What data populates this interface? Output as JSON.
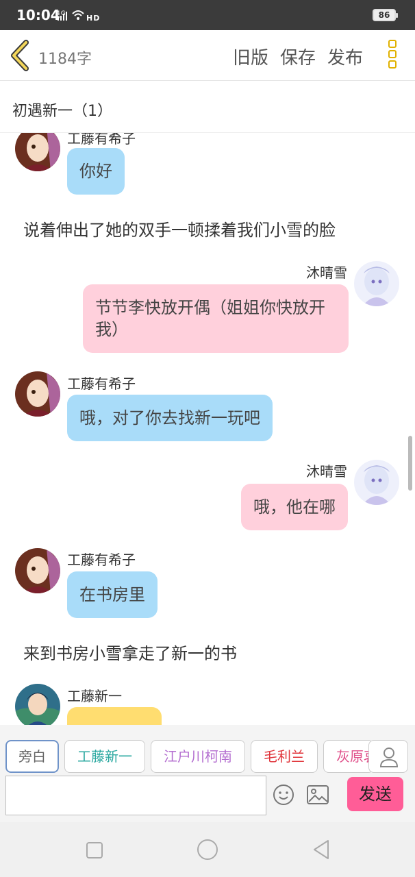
{
  "status": {
    "time": "10:04",
    "network": "4G",
    "hd": "HD",
    "battery": "86"
  },
  "header": {
    "word_count": "1184字",
    "old_version": "旧版",
    "save": "保存",
    "publish": "发布"
  },
  "chapter": {
    "title": "初遇新一（1）"
  },
  "messages": [
    {
      "kind": "left",
      "name": "工藤有希子",
      "text": "你好",
      "color": "#a9dcf9"
    },
    {
      "kind": "narration",
      "text": "说着伸出了她的双手一顿揉着我们小雪的脸"
    },
    {
      "kind": "right",
      "name": "沐晴雪",
      "text": "节节李快放开偶（姐姐你快放开我）",
      "color": "#ffd0dc"
    },
    {
      "kind": "left",
      "name": "工藤有希子",
      "text": "哦，对了你去找新一玩吧",
      "color": "#a9dcf9"
    },
    {
      "kind": "right",
      "name": "沐晴雪",
      "text": "哦，他在哪",
      "color": "#ffd0dc"
    },
    {
      "kind": "left",
      "name": "工藤有希子",
      "text": "在书房里",
      "color": "#a9dcf9"
    },
    {
      "kind": "narration",
      "text": "来到书房小雪拿走了新一的书"
    },
    {
      "kind": "left",
      "name": "工藤新一",
      "text": "",
      "color": "#ffdd70"
    }
  ],
  "characters": [
    {
      "label": "旁白",
      "color": "#666666",
      "selected": true
    },
    {
      "label": "工藤新一",
      "color": "#2aa8a0"
    },
    {
      "label": "江户川柯南",
      "color": "#b46fd0"
    },
    {
      "label": "毛利兰",
      "color": "#e0353b"
    },
    {
      "label": "灰原哀",
      "color": "#e0508a"
    }
  ],
  "composer": {
    "placeholder": "",
    "send": "发送"
  },
  "icons": {
    "back": "chevron-left-icon",
    "more": "more-vertical-icon",
    "person": "person-icon",
    "emoji": "smiley-icon",
    "image": "image-icon",
    "nav_square": "recent-apps-icon",
    "nav_circle": "home-icon",
    "nav_back": "back-triangle-icon"
  },
  "colors": {
    "accent_yellow": "#e0b100",
    "send_pink": "#ff5d97",
    "bubble_blue": "#a9dcf9",
    "bubble_pink": "#ffd0dc"
  }
}
